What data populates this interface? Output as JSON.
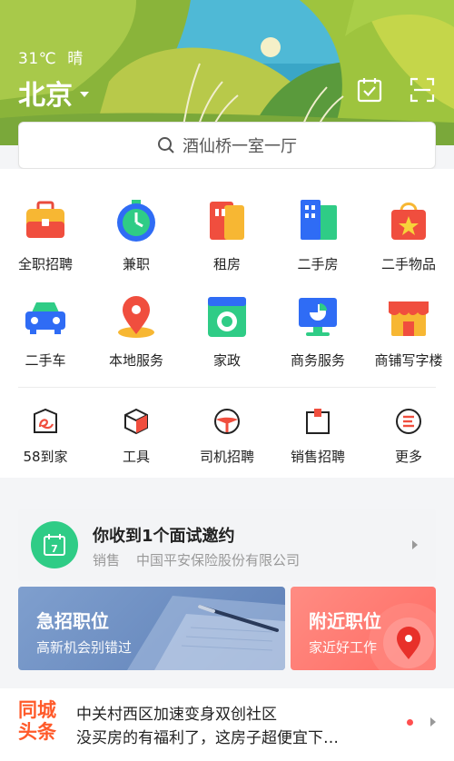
{
  "header": {
    "temperature": "31℃",
    "weather": "晴",
    "city": "北京"
  },
  "search": {
    "placeholder": "酒仙桥一室一厅"
  },
  "categories_row1": [
    {
      "label": "全职招聘",
      "icon": "briefcase-icon"
    },
    {
      "label": "兼职",
      "icon": "stopwatch-icon"
    },
    {
      "label": "租房",
      "icon": "door-icon"
    },
    {
      "label": "二手房",
      "icon": "building-icon"
    },
    {
      "label": "二手物品",
      "icon": "shopping-bag-icon"
    }
  ],
  "categories_row2": [
    {
      "label": "二手车",
      "icon": "car-icon"
    },
    {
      "label": "本地服务",
      "icon": "location-pin-icon"
    },
    {
      "label": "家政",
      "icon": "washing-machine-icon"
    },
    {
      "label": "商务服务",
      "icon": "monitor-chart-icon"
    },
    {
      "label": "商铺写字楼",
      "icon": "storefront-icon"
    }
  ],
  "categories_row3": [
    {
      "label": "58到家",
      "icon": "swan-icon"
    },
    {
      "label": "工具",
      "icon": "cube-icon"
    },
    {
      "label": "司机招聘",
      "icon": "steering-wheel-icon"
    },
    {
      "label": "销售招聘",
      "icon": "clipboard-icon"
    },
    {
      "label": "更多",
      "icon": "menu-circle-icon"
    }
  ],
  "interview": {
    "title": "你收到1个面试邀约",
    "position": "销售",
    "company": "中国平安保险股份有限公司",
    "calendar_day": "7"
  },
  "jobs": {
    "urgent_title": "急招职位",
    "urgent_sub": "高新机会别错过",
    "nearby_title": "附近职位",
    "nearby_sub": "家近好工作"
  },
  "news": {
    "logo_line1": "同城",
    "logo_line2": "头条",
    "line1": "中关村西区加速变身双创社区",
    "line2": "没买房的有福利了，这房子超便宜下…"
  },
  "colors": {
    "accent_red": "#ff4f4f",
    "green": "#2fcc86",
    "urgent_blue": "#6d8dc2",
    "nearby_red": "#ff746c"
  }
}
